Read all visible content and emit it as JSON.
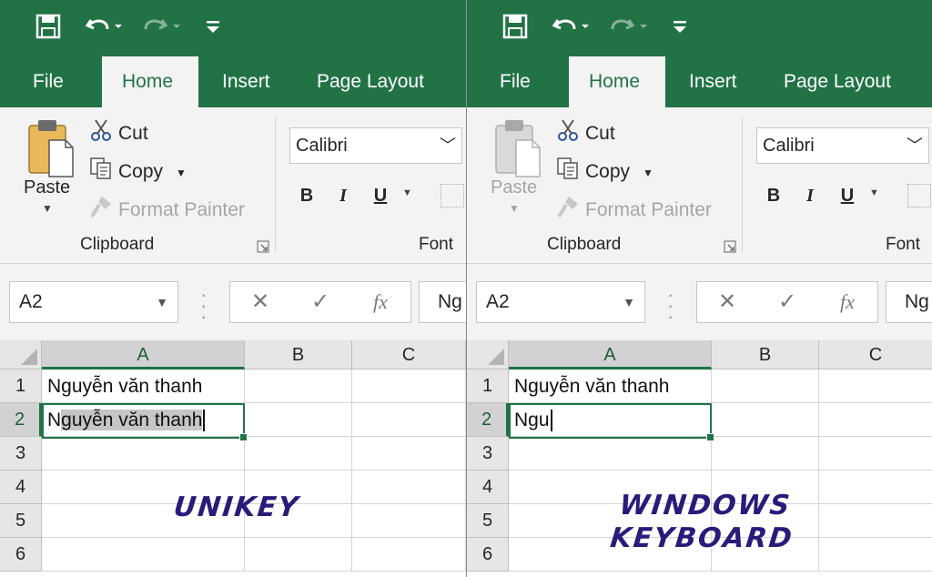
{
  "ribbon": {
    "tabs": [
      "File",
      "Home",
      "Insert",
      "Page Layout"
    ],
    "clipboard": {
      "paste": "Paste",
      "cut": "Cut",
      "copy": "Copy",
      "format_painter": "Format Painter",
      "group": "Clipboard"
    },
    "font": {
      "name": "Calibri",
      "bold": "B",
      "italic": "I",
      "underline": "U",
      "group": "Font"
    }
  },
  "formula_bar": {
    "name_box": "A2",
    "cancel": "✕",
    "enter": "✓",
    "fx": "fx"
  },
  "sheet": {
    "columns": [
      "A",
      "B",
      "C"
    ],
    "rows": [
      "1",
      "2",
      "3",
      "4",
      "5",
      "6"
    ]
  },
  "panels": {
    "left": {
      "formula_text": "Ng",
      "a1": "Nguyễn văn thanh",
      "a2_prefix": "N",
      "a2_highlight": "guyễn văn thanh",
      "caption_line1": "UNIKEY",
      "caption_line2": ""
    },
    "right": {
      "formula_text": "Ng",
      "a1": "Nguyễn văn thanh",
      "a2_prefix": "Ngu",
      "a2_highlight": "",
      "caption_line1": "WINDOWS",
      "caption_line2": "KEYBOARD"
    }
  },
  "colors": {
    "excel_green": "#217346",
    "ribbon_bg": "#f3f3f3",
    "caption": "#2b1a7a"
  }
}
